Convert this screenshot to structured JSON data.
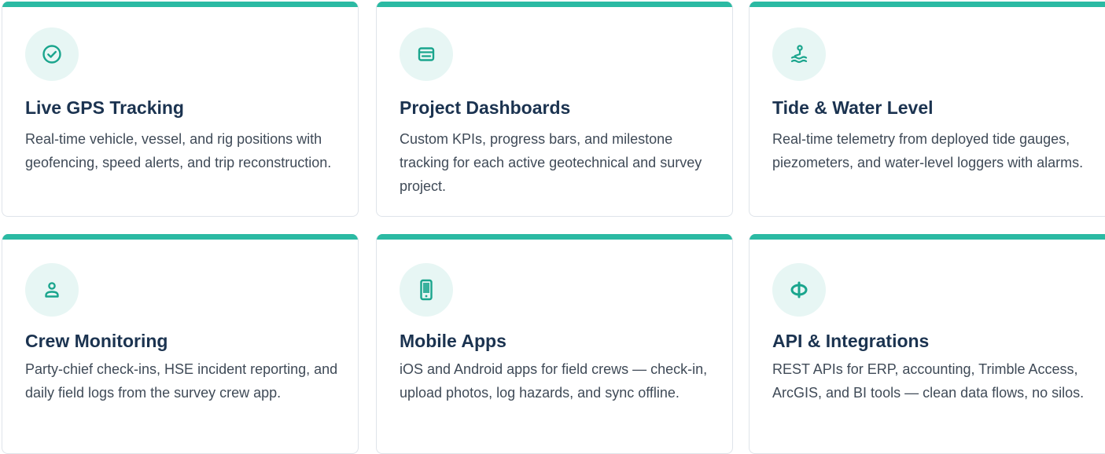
{
  "theme": {
    "accent": "#2bbaa3",
    "icon_bg": "#e7f6f4",
    "title_color": "#1b3350",
    "text_color": "#3f4a57"
  },
  "features": [
    {
      "icon": "check-circle-icon",
      "title": "Live GPS Tracking",
      "description": "Real-time vehicle, vessel, and rig positions with geofencing, speed alerts, and trip reconstruction."
    },
    {
      "icon": "dashboard-list-icon",
      "title": "Project Dashboards",
      "description": "Custom KPIs, progress bars, and milestone tracking for each active geotechnical and survey project."
    },
    {
      "icon": "swimmer-water-icon",
      "title": "Tide & Water Level",
      "description": "Real-time telemetry from deployed tide gauges, piezometers, and water-level loggers with alarms."
    },
    {
      "icon": "user-icon",
      "title": "Crew Monitoring",
      "description": "Party-chief check-ins, HSE incident reporting, and daily field logs from the survey crew app."
    },
    {
      "icon": "mobile-phone-icon",
      "title": "Mobile Apps",
      "description": "iOS and Android apps for field crews — check-in, upload photos, log hazards, and sync offline."
    },
    {
      "icon": "api-link-icon",
      "title": "API & Integrations",
      "description": "REST APIs for ERP, accounting, Trimble Access, ArcGIS, and BI tools — clean data flows, no silos."
    }
  ]
}
